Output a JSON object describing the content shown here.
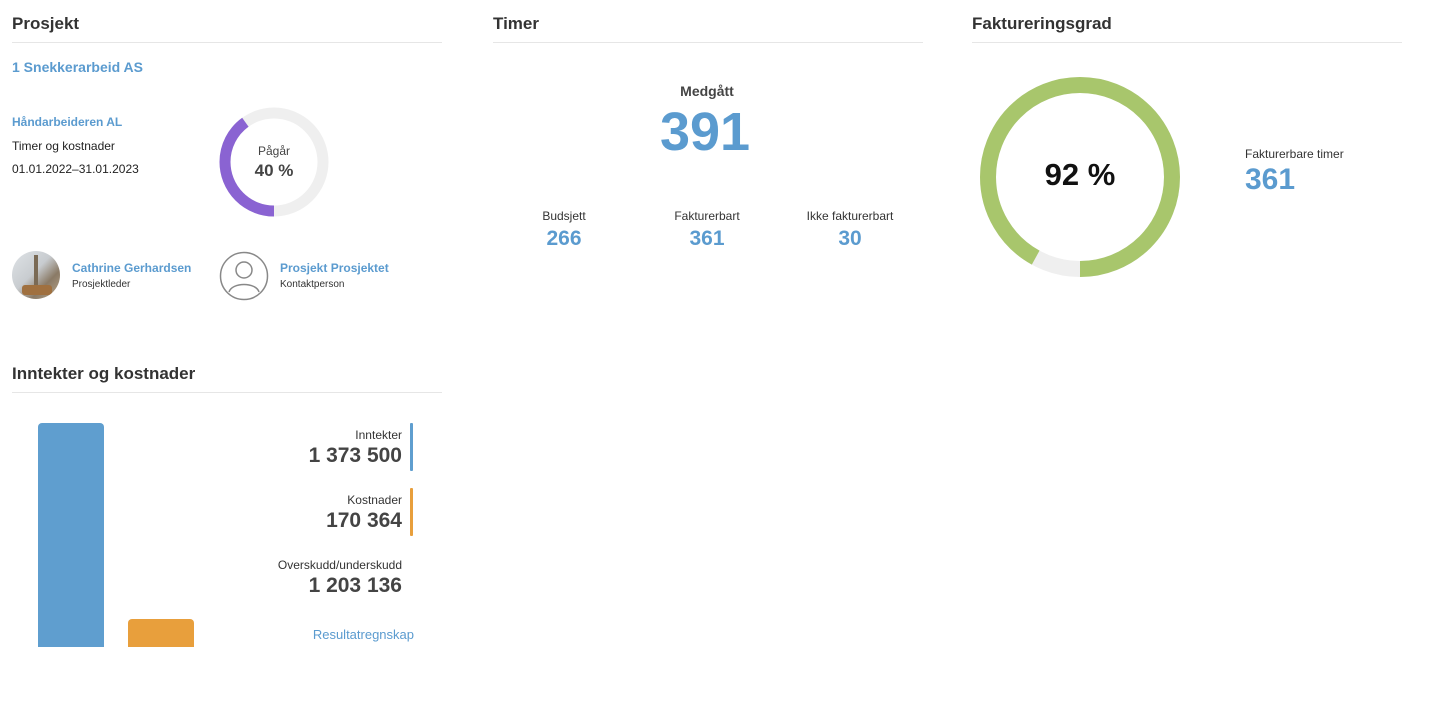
{
  "prosjekt": {
    "title": "Prosjekt",
    "name": "1 Snekkerarbeid AS",
    "customer": "Håndarbeideren AL",
    "type": "Timer og kostnader",
    "period": "01.01.2022–31.01.2023",
    "status_label": "Pågår",
    "progress_text": "40 %",
    "progress_fraction": 0.4,
    "progress_color": "#8a63d2",
    "people": [
      {
        "name": "Cathrine Gerhardsen",
        "role": "Prosjektleder",
        "avatar": "photo"
      },
      {
        "name": "Prosjekt Prosjektet",
        "role": "Kontaktperson",
        "avatar": "user-icon"
      }
    ]
  },
  "timer": {
    "title": "Timer",
    "used_label": "Medgått",
    "used_value": "391",
    "stats": [
      {
        "label": "Budsjett",
        "value": "266"
      },
      {
        "label": "Fakturerbart",
        "value": "361"
      },
      {
        "label": "Ikke fakturerbart",
        "value": "30"
      }
    ]
  },
  "faktureringsgrad": {
    "title": "Faktureringsgrad",
    "percent_text": "92 %",
    "fraction": 0.92,
    "ring_color": "#a8c66c",
    "billable_label": "Fakturerbare timer",
    "billable_value": "361"
  },
  "inntekter": {
    "title": "Inntekter og kostnader",
    "items": [
      {
        "label": "Inntekter",
        "value": "1 373 500",
        "color": "#5f9ecf"
      },
      {
        "label": "Kostnader",
        "value": "170 364",
        "color": "#e89f3c"
      },
      {
        "label": "Overskudd/underskudd",
        "value": "1 203 136"
      }
    ],
    "link": "Resultatregnskap"
  },
  "chart_data": {
    "type": "bar",
    "categories": [
      "Inntekter",
      "Kostnader"
    ],
    "values": [
      1373500,
      170364
    ],
    "colors": [
      "#5f9ecf",
      "#e89f3c"
    ],
    "title": "",
    "xlabel": "",
    "ylabel": ""
  }
}
